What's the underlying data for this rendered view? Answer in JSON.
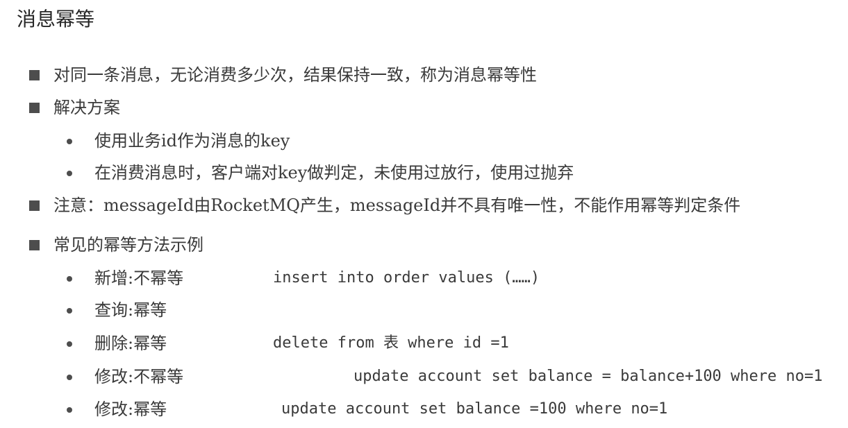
{
  "title": "消息幂等",
  "b1": "对同一条消息，无论消费多少次，结果保持一致，称为消息幂等性",
  "b2": "解决方案",
  "b2_sub1": "使用业务id作为消息的key",
  "b2_sub2": "在消费消息时，客户端对key做判定，未使用过放行，使用过抛弃",
  "b3": "注意：messageId由RocketMQ产生，messageId并不具有唯一性，不能作用幂等判定条件",
  "b4": "常见的幂等方法示例",
  "examples": [
    {
      "label": "新增:不幂等",
      "code": "insert into order values (……)"
    },
    {
      "label": "查询:幂等",
      "code": ""
    },
    {
      "label": "删除:幂等",
      "code": "delete from 表 where id =1"
    },
    {
      "label": "修改:不幂等",
      "code": "update account set balance = balance+100 where no=1"
    },
    {
      "label": "修改:幂等",
      "code": "update account set balance =100 where no=1"
    }
  ]
}
